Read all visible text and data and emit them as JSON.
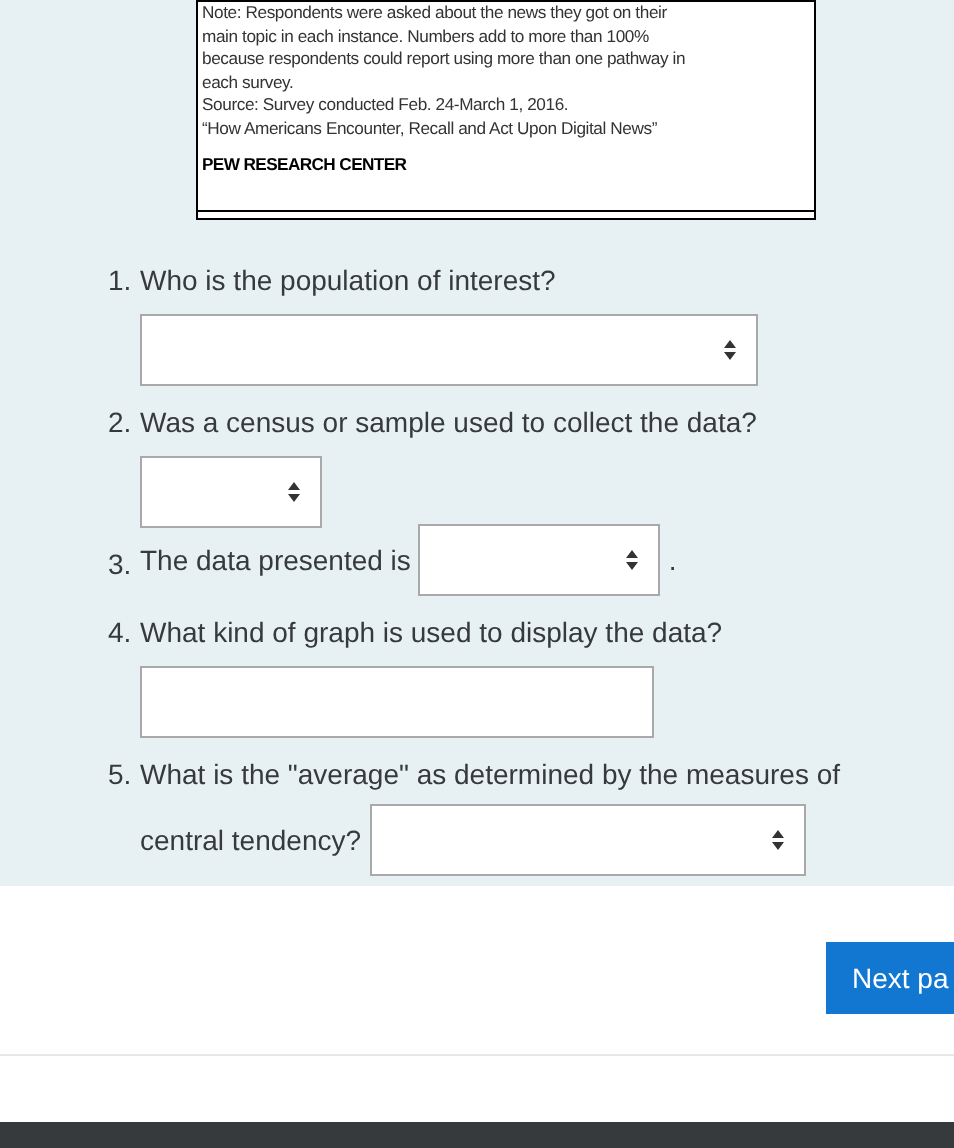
{
  "figure": {
    "note_lines": [
      "Note: Respondents were asked about the news they got on their",
      "main topic in each instance. Numbers add to more than 100%",
      "because respondents could report using more than one pathway in",
      "each survey.",
      "Source: Survey conducted Feb. 24-March 1, 2016.",
      "“How Americans Encounter, Recall and Act Upon Digital News”"
    ],
    "credit": "PEW RESEARCH CENTER"
  },
  "questions": [
    {
      "number": "1.",
      "text": "Who is the population of interest?",
      "kind": "select-below"
    },
    {
      "number": "2.",
      "text": "Was a census or sample used to collect the data?",
      "kind": "select-below-small"
    },
    {
      "number": "3.",
      "text": "The data presented is",
      "kind": "select-inline",
      "after": "."
    },
    {
      "number": "4.",
      "text": "What kind of graph is used to display the data?",
      "kind": "text-below"
    },
    {
      "number": "5.",
      "text": "What is the \"average\" as determined by the measures of",
      "text2": "central tendency?",
      "kind": "select-wrap"
    }
  ],
  "next_button": "Next pa"
}
